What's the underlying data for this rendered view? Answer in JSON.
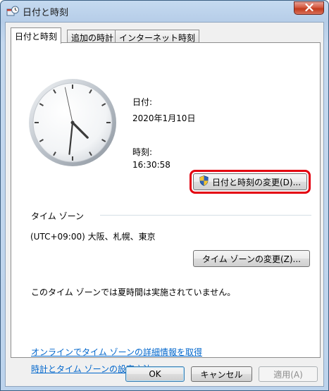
{
  "window": {
    "title": "日付と時刻"
  },
  "tabs": [
    {
      "label": "日付と時刻"
    },
    {
      "label": "追加の時計"
    },
    {
      "label": "インターネット時刻"
    }
  ],
  "date": {
    "label": "日付:",
    "value": "2020年1月10日"
  },
  "time": {
    "label": "時刻:",
    "value": "16:30:58"
  },
  "change_datetime_button": "日付と時刻の変更(D)...",
  "timezone": {
    "section_label": "タイム ゾーン",
    "value": "(UTC+09:00) 大阪、札幌、東京",
    "change_button": "タイム ゾーンの変更(Z)...",
    "dst_note": "このタイム ゾーンでは夏時間は実施されていません。"
  },
  "links": {
    "timezone_info": "オンラインでタイム ゾーンの詳細情報を取得",
    "how_to_set": "時計とタイム ゾーンの設定方法"
  },
  "footer": {
    "ok": "OK",
    "cancel": "キャンセル",
    "apply": "適用(A)"
  },
  "clock_time": {
    "hour": 16,
    "minute": 30,
    "second": 58
  },
  "icons": [
    "clock-app-icon",
    "close-icon",
    "uac-shield-icon"
  ],
  "colors": {
    "highlight": "#e3000f",
    "link": "#0066cc",
    "close_button": "#c23a1c"
  }
}
